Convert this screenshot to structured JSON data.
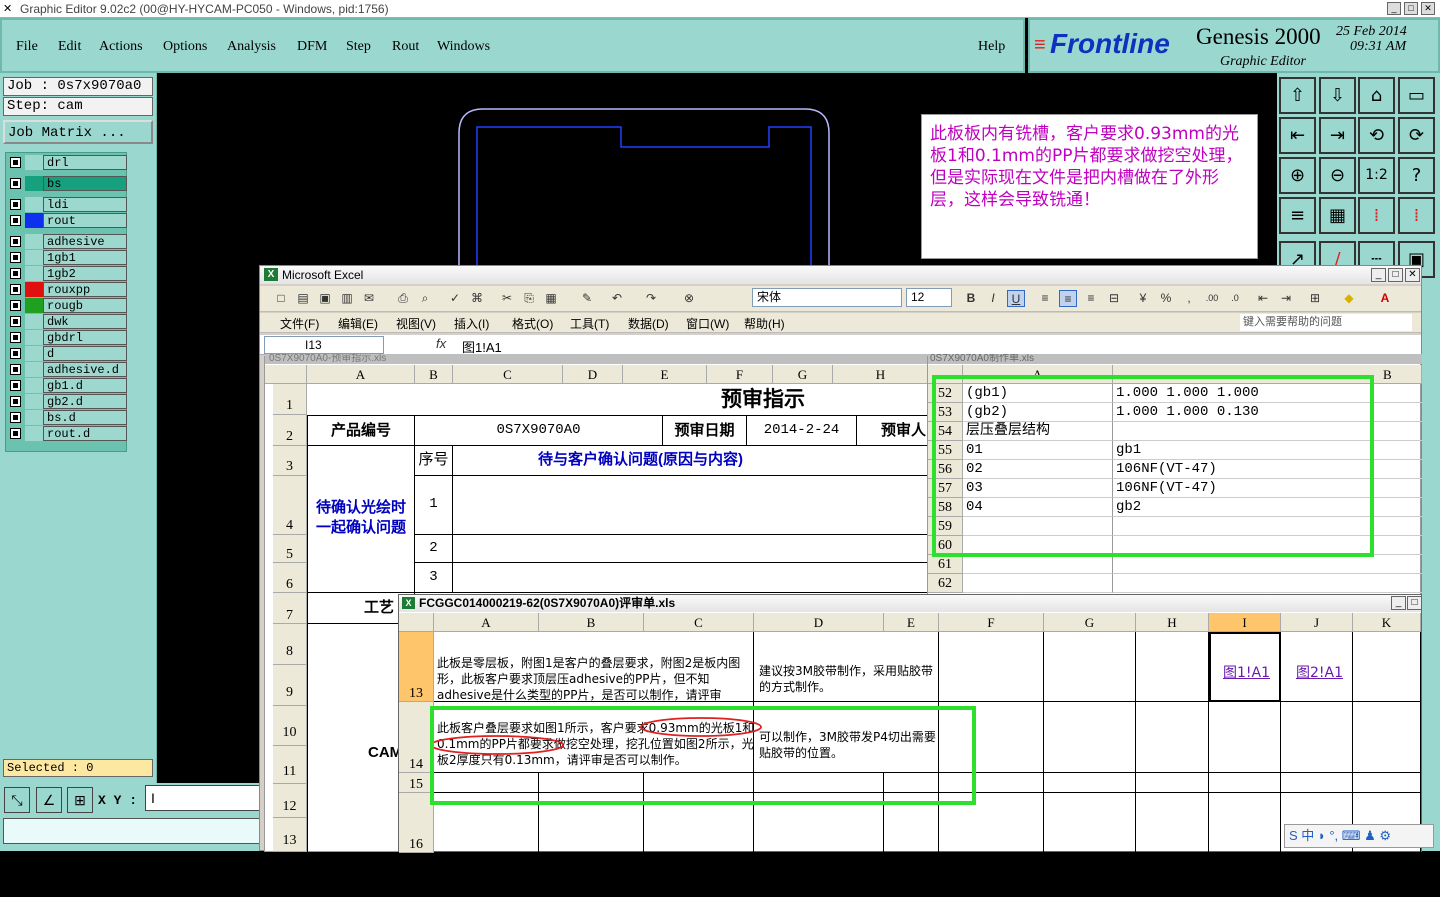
{
  "window": {
    "title": "Graphic Editor 9.02c2 (00@HY-HYCAM-PC050 - Windows, pid:1756)"
  },
  "menu": {
    "items": [
      "File",
      "Edit",
      "Actions",
      "Options",
      "Analysis",
      "DFM",
      "Step",
      "Rout",
      "Windows"
    ],
    "help": "Help"
  },
  "brand": {
    "logo": "Frontline",
    "product": "Genesis 2000",
    "subtitle": "Graphic Editor",
    "date": "25 Feb 2014",
    "time": "09:31 AM"
  },
  "job": {
    "job_label": "Job : 0s7x9070a0",
    "step_label": "Step: cam",
    "matrix_button": "Job Matrix ..."
  },
  "layers": [
    {
      "name": "drl",
      "color": "#9dd8ce"
    },
    {
      "name": "bs",
      "color": "#16a07e"
    },
    {
      "name": "ldi",
      "color": "#9dd8ce"
    },
    {
      "name": "rout",
      "color": "#1030f0"
    },
    {
      "name": "adhesive",
      "color": "#9dd8ce"
    },
    {
      "name": "1gb1",
      "color": "#9dd8ce"
    },
    {
      "name": "1gb2",
      "color": "#9dd8ce"
    },
    {
      "name": "rouxpp",
      "color": "#e01010"
    },
    {
      "name": "rougb",
      "color": "#20a020"
    },
    {
      "name": "dwk",
      "color": "#9dd8ce"
    },
    {
      "name": "gbdrl",
      "color": "#9dd8ce"
    },
    {
      "name": "d",
      "color": "#9dd8ce"
    },
    {
      "name": "adhesive.d",
      "color": "#9dd8ce"
    },
    {
      "name": "gb1.d",
      "color": "#9dd8ce"
    },
    {
      "name": "gb2.d",
      "color": "#9dd8ce"
    },
    {
      "name": "bs.d",
      "color": "#9dd8ce"
    },
    {
      "name": "rout.d",
      "color": "#9dd8ce"
    }
  ],
  "status": {
    "selected": "Selected : 0",
    "xy_label": "X Y :",
    "xy_value": "I"
  },
  "note": "此板板内有铣槽，客户要求0.93mm的光板1和0.1mm的PP片都要求做挖空处理，但是实际现在文件是把内槽做在了外形层，这样会导致铣通！",
  "excel": {
    "title": "Microsoft Excel",
    "font": "宋体",
    "size": "12",
    "menu": [
      "文件(F)",
      "编辑(E)",
      "视图(V)",
      "插入(I)",
      "格式(O)",
      "工具(T)",
      "数据(D)",
      "窗口(W)",
      "帮助(H)"
    ],
    "help_placeholder": "键入需要帮助的问题",
    "name_box": "I13",
    "fx": "fx",
    "formula": "图1!A1",
    "sheet1": {
      "title": "0S7X9070A0-预审指示.xls",
      "columns": [
        "A",
        "B",
        "C",
        "D",
        "E",
        "F",
        "G",
        "H"
      ],
      "rows": [
        "1",
        "2",
        "3",
        "4",
        "5",
        "6",
        "7",
        "8",
        "9",
        "10",
        "11",
        "12",
        "13"
      ],
      "heading": "预审指示",
      "product_no_label": "产品编号",
      "product_no": "0S7X9070A0",
      "date_label": "预审日期",
      "date": "2014-2-24",
      "reviewer_label": "预审人",
      "seq_label": "序号",
      "question_label": "待与客户确认问题(原因与内容)",
      "pending_label": "待确认光绘时一起确认问题",
      "seq": [
        "1",
        "2",
        "3"
      ],
      "process_label": "工艺",
      "cam_label": "CAM"
    },
    "sheet2": {
      "title": "0S7X9070A0制作单.xls",
      "columns": [
        "A",
        "B"
      ],
      "rows": [
        "52",
        "53",
        "54",
        "55",
        "56",
        "57",
        "58",
        "59",
        "60",
        "61",
        "62"
      ],
      "cells_a": [
        "(gb1)",
        "(gb2)",
        "层压叠层结构",
        "01",
        "02",
        "03",
        "04",
        "",
        "",
        "",
        ""
      ],
      "cells_b": [
        "1.000  1.000   1.000",
        "1.000  1.000           0.130",
        "",
        "gb1",
        "106NF(VT-47)",
        "106NF(VT-47)",
        "gb2",
        "",
        "",
        "",
        ""
      ]
    },
    "review": {
      "title": "FCGGC014000219-62(0S7X9070A0)评审单.xls",
      "columns": [
        "A",
        "B",
        "C",
        "D",
        "E",
        "F",
        "G",
        "H",
        "I",
        "J",
        "K"
      ],
      "rows": [
        "13",
        "14",
        "15",
        "16"
      ],
      "r13_a": "此板是零层板，附图1是客户的叠层要求，附图2是板内图形，此板客户要求顶层压adhesive的PP片，但不知adhesive是什么类型的PP片，是否可以制作，请评审",
      "r13_d": "建议按3M胶带制作，采用贴胶带的方式制作。",
      "link1": "图1!A1",
      "link2": "图2!A1",
      "r14_a": "此板客户叠层要求如图1所示，客户要求0.93mm的光板1和0.1mm的PP片都要求做挖空处理，挖孔位置如图2所示，光板2厚度只有0.13mm，请评审是否可以制作。",
      "r14_d": "可以制作，3M胶带发P4切出需要贴胶带的位置。"
    }
  },
  "ime": "S 中 ◗ °, ⌨ ♟ ⚙",
  "colors": {
    "panel": "#9ad8cf",
    "highlight": "#2ee02e",
    "note_text": "#c000c0"
  }
}
